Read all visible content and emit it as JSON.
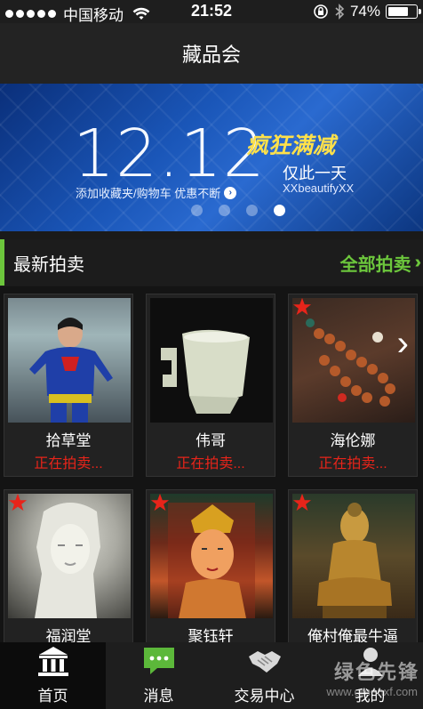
{
  "status_bar": {
    "carrier": "中国移动",
    "time": "21:52",
    "battery": "74%",
    "battery_level": 0.74
  },
  "nav": {
    "title": "藏品会"
  },
  "banner": {
    "date": "12.12",
    "promo": "疯狂满减",
    "sub1": "仅此一天",
    "sub2": "添加收藏夹/购物车  优惠不断",
    "brand": "XXbeautifyXX",
    "slides": 4,
    "active_slide": 4
  },
  "section": {
    "title": "最新拍卖",
    "more": "全部拍卖"
  },
  "auctions": [
    {
      "name": "拾草堂",
      "status": "正在拍卖...",
      "starred": false
    },
    {
      "name": "伟哥",
      "status": "正在拍卖...",
      "starred": false
    },
    {
      "name": "海伦娜",
      "status": "正在拍卖...",
      "starred": true
    },
    {
      "name": "福润堂",
      "status": "",
      "starred": true
    },
    {
      "name": "聚钰轩",
      "status": "",
      "starred": true
    },
    {
      "name": "俺村俺最牛逼",
      "status": "",
      "starred": true
    }
  ],
  "tabs": [
    {
      "label": "首页",
      "icon": "museum-icon",
      "active": true
    },
    {
      "label": "消息",
      "icon": "message-icon",
      "active": false
    },
    {
      "label": "交易中心",
      "icon": "handshake-icon",
      "active": false
    },
    {
      "label": "我的",
      "icon": "user-icon",
      "active": false
    }
  ],
  "watermark": {
    "text": "绿色先锋",
    "url": "www.greenxf.com"
  },
  "colors": {
    "accent": "#6cc63c",
    "status_red": "#e8241a",
    "promo_yellow": "#ffe14a",
    "banner_blue": "#1a56b8"
  }
}
